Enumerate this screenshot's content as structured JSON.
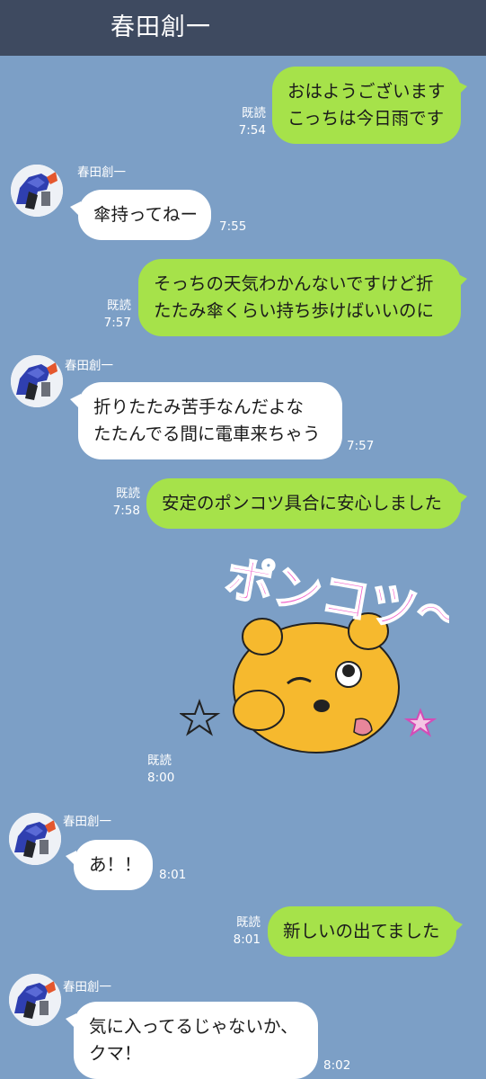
{
  "header": {
    "title": "春田創一"
  },
  "colors": {
    "background": "#7c9fc6",
    "header": "#3e4a60",
    "outgoing": "#a6e24a",
    "incoming": "#ffffff"
  },
  "sender_name": "春田創一",
  "read_label": "既読",
  "messages": [
    {
      "dir": "out",
      "lines": [
        "おはようございます",
        "こっちは今日雨です"
      ],
      "time": "7:54",
      "read": true
    },
    {
      "dir": "in",
      "lines": [
        "傘持ってねー"
      ],
      "time": "7:55"
    },
    {
      "dir": "out",
      "lines": [
        "そっちの天気わかんないですけど折",
        "たたみ傘くらい持ち歩けばいいのに"
      ],
      "time": "7:57",
      "read": true
    },
    {
      "dir": "in",
      "lines": [
        "折りたたみ苦手なんだよな",
        "たたんでる間に電車来ちゃう"
      ],
      "time": "7:57"
    },
    {
      "dir": "out",
      "lines": [
        "安定のポンコツ具合に安心しました"
      ],
      "time": "7:58",
      "read": true
    },
    {
      "dir": "out",
      "sticker": {
        "text": "ポンコツ〜ン",
        "icon": "bear-sticker-icon"
      },
      "time": "8:00",
      "read": true
    },
    {
      "dir": "in",
      "lines": [
        "あ！！"
      ],
      "time": "8:01"
    },
    {
      "dir": "out",
      "lines": [
        "新しいの出てました"
      ],
      "time": "8:01",
      "read": true
    },
    {
      "dir": "in",
      "lines": [
        "気に入ってるじゃないか、",
        "クマ！"
      ],
      "time": "8:02"
    }
  ]
}
